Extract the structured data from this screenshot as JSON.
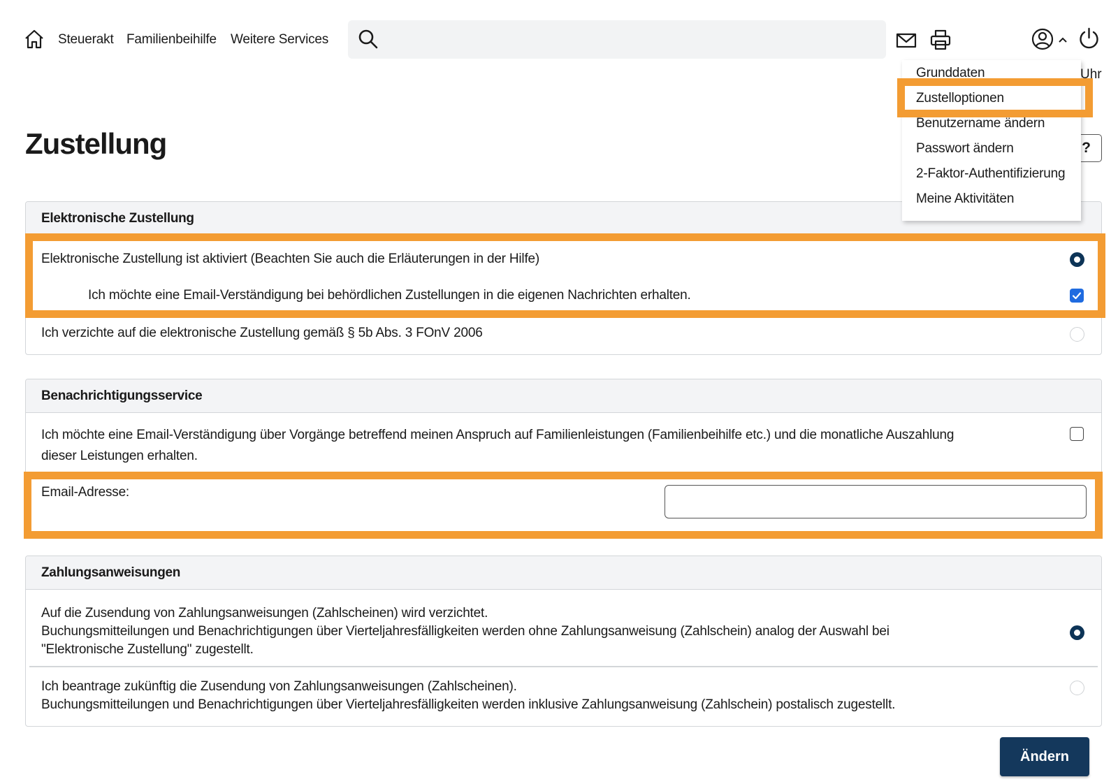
{
  "nav": {
    "links": [
      "Steuerakt",
      "Familienbeihilfe",
      "Weitere Services"
    ],
    "search_placeholder": "",
    "icons": [
      "home-icon",
      "search-icon",
      "mail-icon",
      "print-icon",
      "user-icon",
      "chevron-up-icon",
      "power-icon"
    ]
  },
  "dropdown": {
    "items": [
      "Grunddaten",
      "Zustelloptionen",
      "Benutzername ändern",
      "Passwort ändern",
      "2-Faktor-Authentifizierung",
      "Meine Aktivitäten"
    ]
  },
  "header": {
    "partial_text": "Uhr",
    "help_label": "?"
  },
  "page": {
    "title": "Zustellung"
  },
  "electronic": {
    "title": "Elektronische Zustellung",
    "option_activated": "Elektronische Zustellung ist aktiviert (Beachten Sie auch die Erläuterungen in der Hilfe)",
    "option_email_notify": "Ich möchte eine Email-Verständigung bei behördlichen Zustellungen in die eigenen Nachrichten erhalten.",
    "option_waive": "Ich verzichte auf die elektronische Zustellung gemäß § 5b Abs. 3 FOnV 2006",
    "activated_selected": true,
    "email_notify_checked": true,
    "waive_selected": false
  },
  "notification": {
    "title": "Benachrichtigungsservice",
    "option_line1": "Ich möchte eine Email-Verständigung über Vorgänge betreffend meinen Anspruch auf Familienleistungen (Familienbeihilfe etc.) und die monatliche Auszahlung",
    "option_line2": "dieser Leistungen erhalten.",
    "option_checked": false,
    "email_label": "Email-Adresse:",
    "email_value": ""
  },
  "payment": {
    "title": "Zahlungsanweisungen",
    "option1_line1": "Auf die Zusendung von Zahlungsanweisungen (Zahlscheinen) wird verzichtet.",
    "option1_line2": "Buchungsmitteilungen und Benachrichtigungen über Vierteljahresfälligkeiten werden ohne Zahlungsanweisung (Zahlschein) analog der Auswahl bei",
    "option1_line3": "\"Elektronische Zustellung\" zugestellt.",
    "option2_line1": "Ich beantrage zukünftig die Zusendung von Zahlungsanweisungen (Zahlscheinen).",
    "option2_line2": "Buchungsmitteilungen und Benachrichtigungen über Vierteljahresfälligkeiten werden inklusive Zahlungsanweisung (Zahlschein) postalisch zugestellt.",
    "option1_selected": true,
    "option2_selected": false
  },
  "actions": {
    "submit_label": "Ändern"
  },
  "colors": {
    "highlight": "#f39c33",
    "primary": "#14385c",
    "radio_selected": "#0d3457",
    "checkbox_checked": "#1f6be0"
  }
}
